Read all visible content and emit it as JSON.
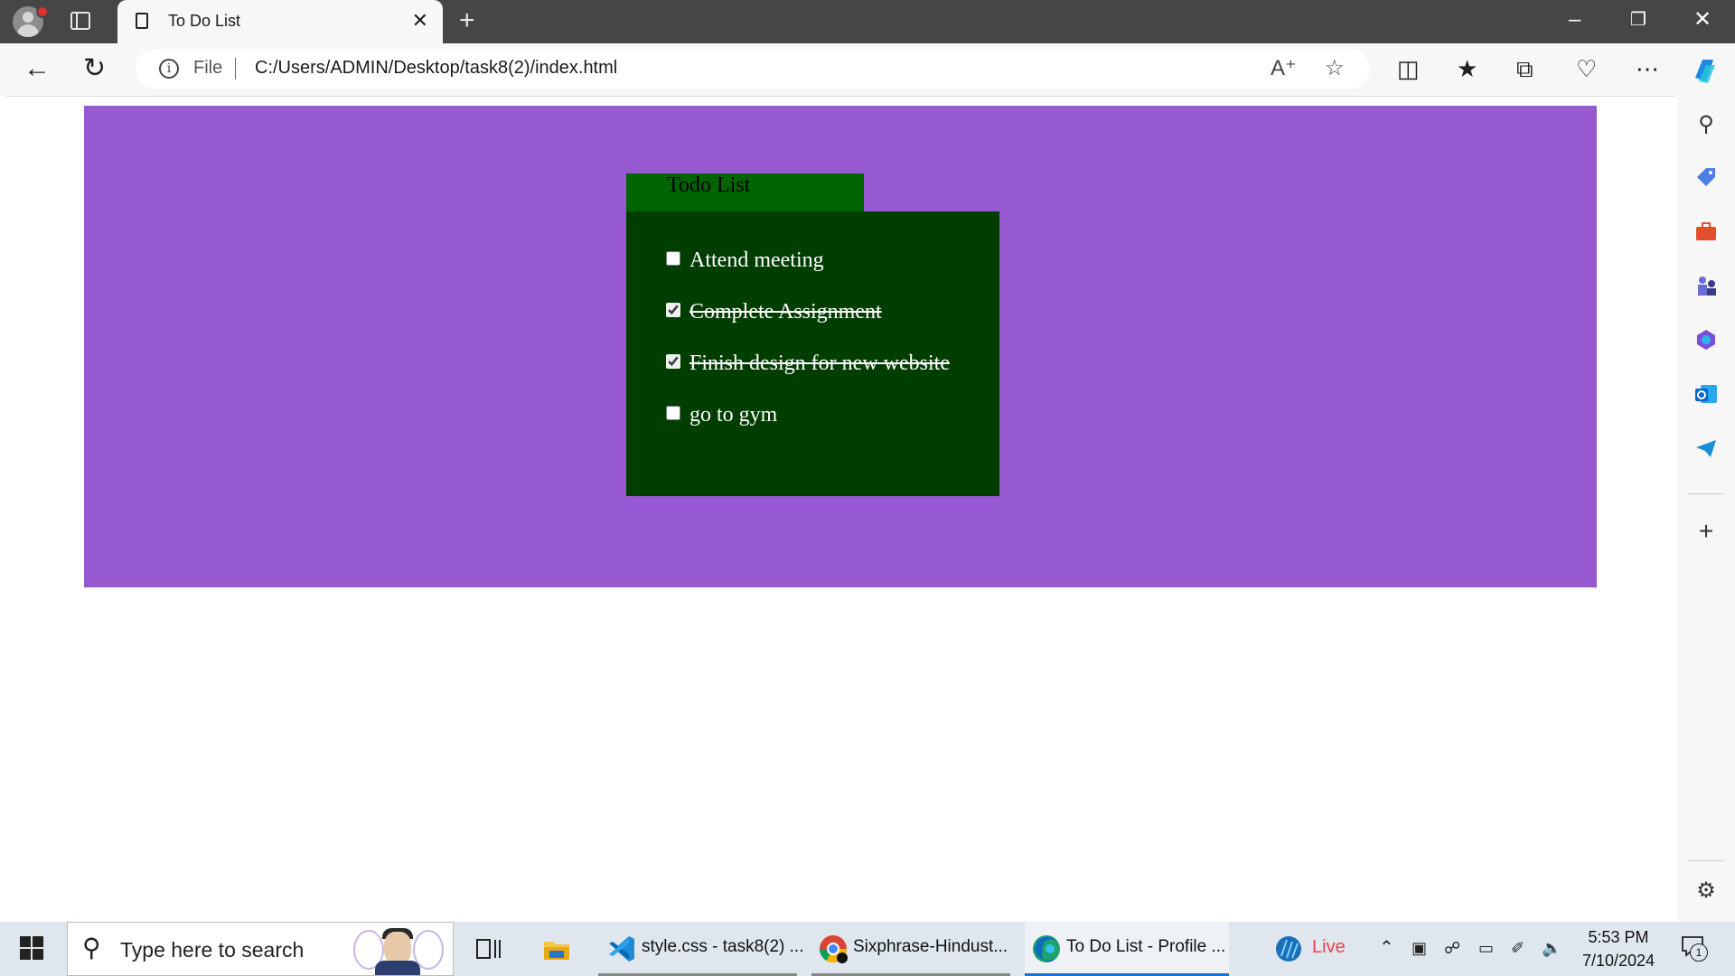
{
  "browser": {
    "tab_title": "To Do List",
    "new_tab_symbol": "+",
    "close_tab_symbol": "✕",
    "address": {
      "scheme_label": "File",
      "url": "C:/Users/ADMIN/Desktop/task8(2)/index.html"
    },
    "window_controls": {
      "minimize": "–",
      "restore": "❐",
      "close": "✕"
    },
    "icons": [
      "back-icon",
      "refresh-icon",
      "info-icon",
      "read-aloud-icon",
      "favorite-star-icon",
      "split-screen-icon",
      "favorites-icon",
      "collections-icon",
      "browser-essentials-icon",
      "more-icon",
      "copilot-icon"
    ]
  },
  "sidebar": {
    "icons": [
      "search-icon",
      "shopping-tag-icon",
      "tools-icon",
      "games-icon",
      "microsoft365-icon",
      "outlook-icon",
      "telegram-icon",
      "add-icon",
      "settings-icon"
    ]
  },
  "page": {
    "colors": {
      "background": "#9659d1",
      "header": "#006400",
      "list_box": "#003e00",
      "text": "#ffffff"
    },
    "todo": {
      "title": "Todo List",
      "items": [
        {
          "text": "Attend meeting",
          "checked": false
        },
        {
          "text": "Complete Assignment",
          "checked": true
        },
        {
          "text": "Finish design for new website",
          "checked": true
        },
        {
          "text": "go to gym",
          "checked": false
        }
      ]
    }
  },
  "taskbar": {
    "search_placeholder": "Type here to search",
    "apps": [
      {
        "label": "style.css - task8(2) ...",
        "icon": "vscode-icon"
      },
      {
        "label": "Sixphrase-Hindust...",
        "icon": "chrome-icon"
      },
      {
        "label": "To Do List - Profile ...",
        "icon": "edge-icon"
      }
    ],
    "weather_label": "Live",
    "clock": {
      "time": "5:53 PM",
      "date": "7/10/2024"
    },
    "notification_count": "1"
  }
}
